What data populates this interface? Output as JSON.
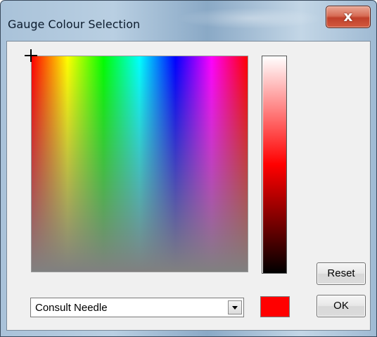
{
  "window": {
    "title": "Gauge Colour Selection",
    "close_glyph": "x"
  },
  "picker": {
    "selected_color": "#ff0000",
    "spectrum_hues": [
      "#ff0000",
      "#ffff00",
      "#00ff00",
      "#00ffff",
      "#0000ff",
      "#ff00ff",
      "#ff0000"
    ],
    "luminance_colors": [
      "#ffffff",
      "#ff0000",
      "#000000"
    ],
    "crosshair_icon": "crosshair-icon"
  },
  "controls": {
    "reset_label": "Reset",
    "ok_label": "OK",
    "gauge_select": {
      "value": "Consult Needle",
      "arrow_icon": "chevron-down-icon"
    }
  }
}
